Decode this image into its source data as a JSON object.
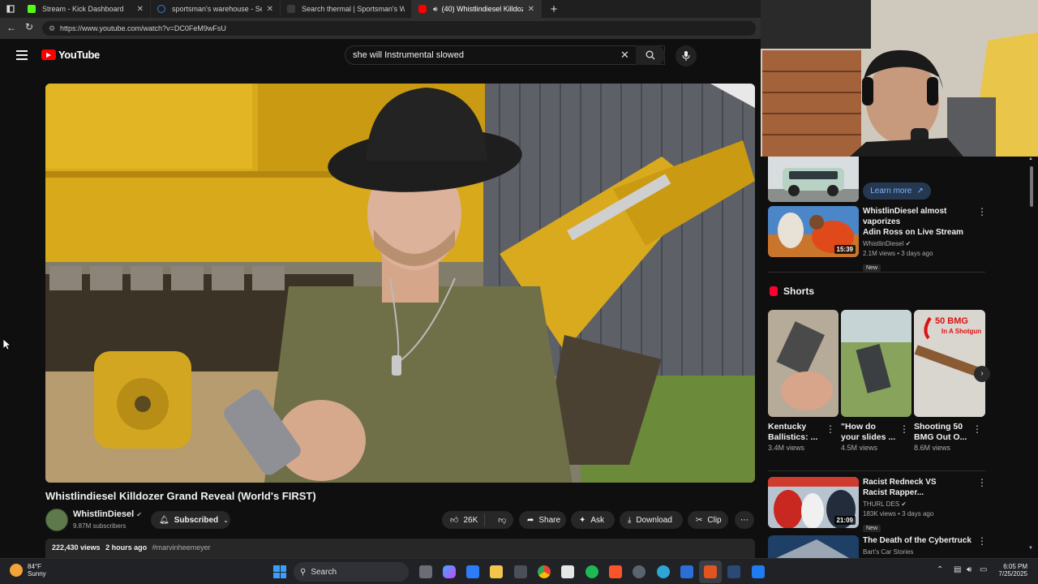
{
  "browser": {
    "tabs": [
      {
        "title": "Stream - Kick Dashboard",
        "fav_color": "#53fc18"
      },
      {
        "title": "sportsman's warehouse - Search",
        "fav_color": "#3a7bd5"
      },
      {
        "title": "Search thermal | Sportsman's Wa",
        "fav_color": "#555555"
      },
      {
        "title": "(40) Whistlindiesel Killdozer",
        "fav_color": "#ff0000"
      }
    ],
    "new_tab": "+",
    "url": "https://www.youtube.com/watch?v=DC0FeM9wFsU"
  },
  "youtube": {
    "logo_text": "YouTube",
    "search_value": "she will Instrumental slowed",
    "video": {
      "title": "Whistlindiesel Killdozer Grand Reveal (World's FIRST)",
      "channel": "WhistlinDiesel",
      "subscribers": "9.87M subscribers",
      "subscribed_label": "Subscribed",
      "likes": "26K",
      "share": "Share",
      "ask": "Ask",
      "download": "Download",
      "clip": "Clip",
      "views": "222,430 views",
      "time": "2 hours ago",
      "hashtag": "#marvinheemeyer"
    },
    "sidebar": {
      "ad_button": "Learn more",
      "videos": [
        {
          "title_line1": "WhistlinDiesel almost vaporizes",
          "title_line2": "Adin Ross on Live Stream",
          "channel": "WhistlinDiesel",
          "meta": "2.1M views • 3 days ago",
          "badge": "New",
          "duration": "15:39"
        },
        {
          "title_line1": "Racist Redneck VS",
          "title_line2": "Racist Rapper...",
          "channel": "THURL DES",
          "meta": "183K views • 3 days ago",
          "badge": "New",
          "duration": "21:09"
        },
        {
          "title_line1": "The Death of the Cybertruck",
          "title_line2": "",
          "channel": "Bart's Car Stories",
          "meta": "",
          "badge": "",
          "duration": ""
        }
      ],
      "shorts_heading": "Shorts",
      "shorts": [
        {
          "title_line1": "Kentucky",
          "title_line2": "Ballistics: ...",
          "views": "3.4M views"
        },
        {
          "title_line1": "\"How do",
          "title_line2": "your slides ...",
          "views": "4.5M views"
        },
        {
          "title_line1": "Shooting 50",
          "title_line2": "BMG Out O...",
          "views": "8.6M views",
          "overlay1": "50 BMG",
          "overlay2": "In A Shotgun"
        }
      ]
    }
  },
  "taskbar": {
    "weather_temp": "84°F",
    "weather_desc": "Sunny",
    "search_label": "Search",
    "time": "6:05 PM",
    "date": "7/25/2025"
  },
  "colors": {
    "youtube_red": "#ff0000",
    "bulldozer_yellow": "#e0b21a",
    "shirt_green": "#6f7048"
  }
}
